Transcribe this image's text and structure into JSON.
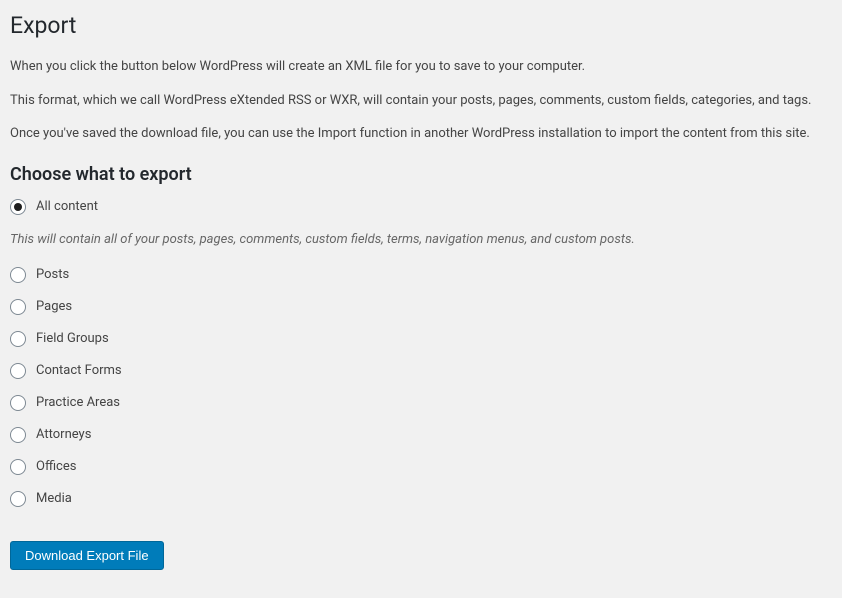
{
  "page": {
    "title": "Export",
    "intro1": "When you click the button below WordPress will create an XML file for you to save to your computer.",
    "intro2": "This format, which we call WordPress eXtended RSS or WXR, will contain your posts, pages, comments, custom fields, categories, and tags.",
    "intro3": "Once you've saved the download file, you can use the Import function in another WordPress installation to import the content from this site."
  },
  "choose": {
    "heading": "Choose what to export",
    "hint": "This will contain all of your posts, pages, comments, custom fields, terms, navigation menus, and custom posts."
  },
  "options": {
    "all": "All content",
    "posts": "Posts",
    "pages": "Pages",
    "field_groups": "Field Groups",
    "contact_forms": "Contact Forms",
    "practice_areas": "Practice Areas",
    "attorneys": "Attorneys",
    "offices": "Offices",
    "media": "Media"
  },
  "button": {
    "download": "Download Export File"
  }
}
